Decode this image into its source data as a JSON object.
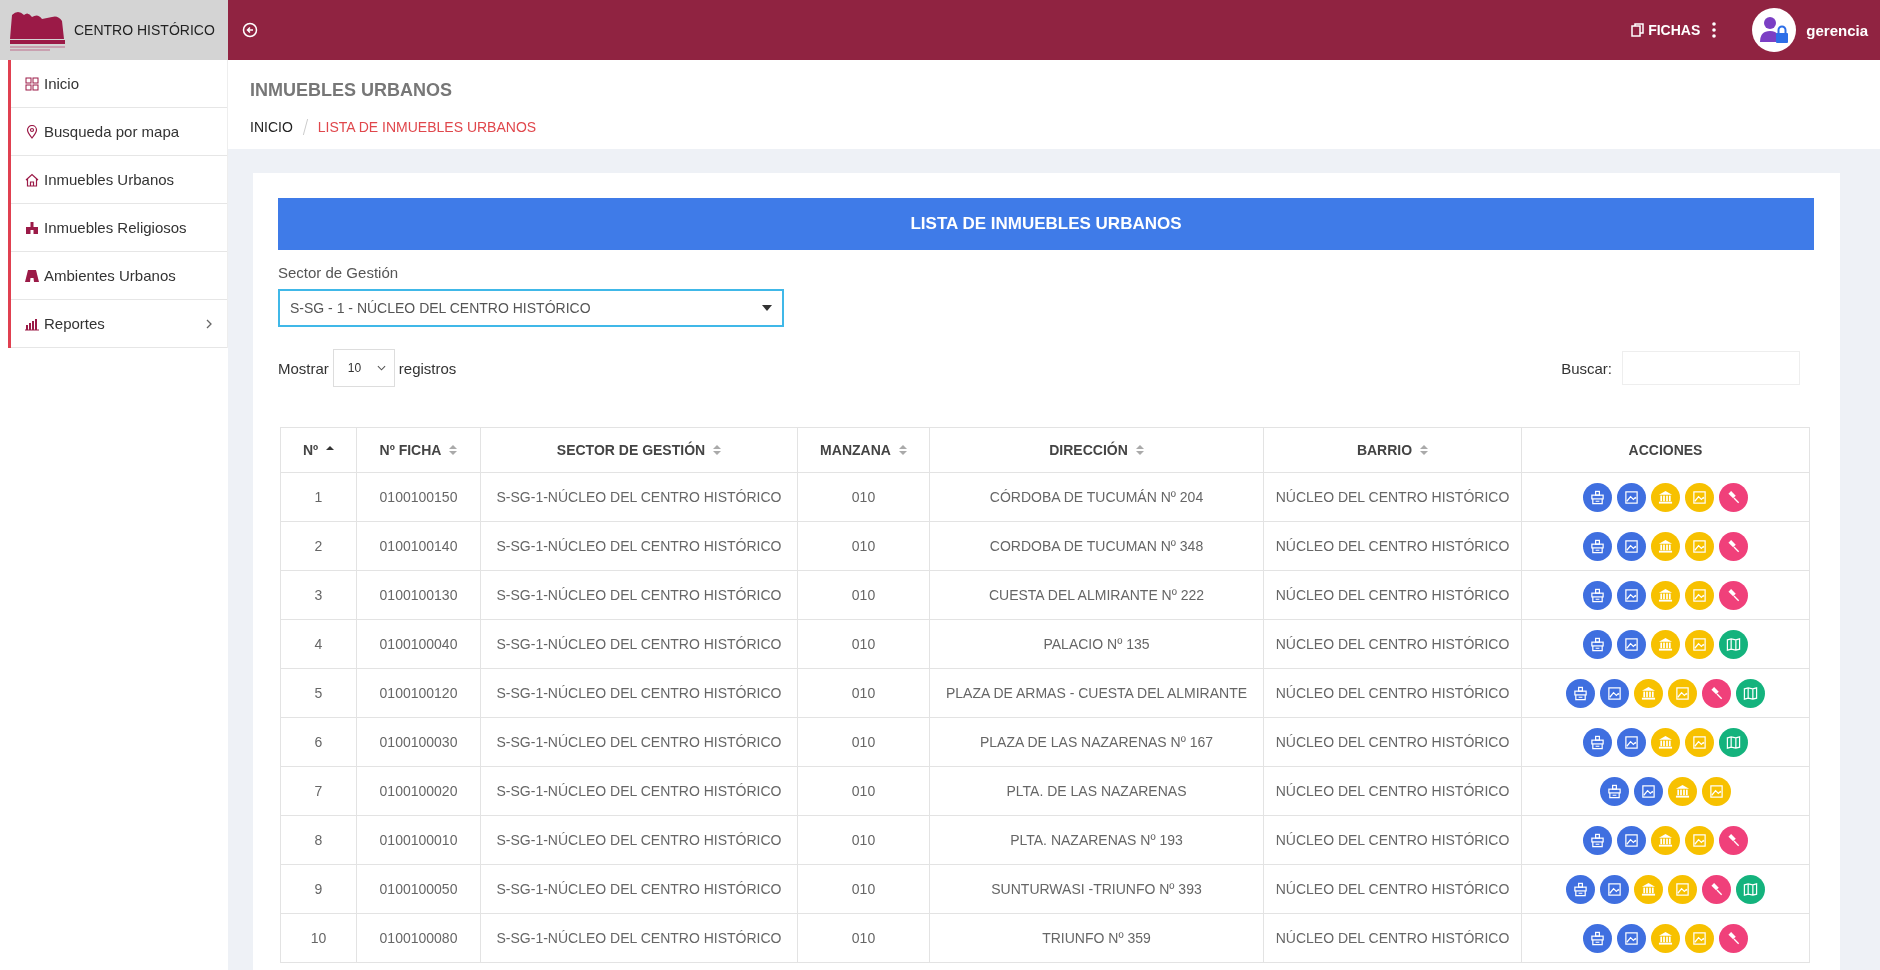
{
  "brand": {
    "title": "CENTRO HISTÓRICO"
  },
  "topbar": {
    "fichas_label": "FICHAS",
    "user": "gerencia"
  },
  "sidebar": {
    "items": [
      {
        "label": "Inicio",
        "kind": "grid",
        "has_submenu": false
      },
      {
        "label": "Busqueda por mapa",
        "kind": "pin",
        "has_submenu": false
      },
      {
        "label": "Inmuebles Urbanos",
        "kind": "house",
        "has_submenu": false
      },
      {
        "label": "Inmuebles Religiosos",
        "kind": "church",
        "has_submenu": false
      },
      {
        "label": "Ambientes Urbanos",
        "kind": "road",
        "has_submenu": false
      },
      {
        "label": "Reportes",
        "kind": "chart",
        "has_submenu": true
      }
    ]
  },
  "page": {
    "title": "INMUEBLES URBANOS",
    "breadcrumb": [
      {
        "label": "INICIO",
        "current": false
      },
      {
        "label": "LISTA DE INMUEBLES URBANOS",
        "current": true
      }
    ]
  },
  "panel": {
    "title": "LISTA DE INMUEBLES URBANOS",
    "filter_label": "Sector de Gestión",
    "filter_value": "S-SG - 1 - NÚCLEO DEL CENTRO HISTÓRICO",
    "show_before": "Mostrar",
    "show_value": "10",
    "show_after": "registros",
    "search_label": "Buscar:"
  },
  "table": {
    "columns": [
      {
        "label": "Nº",
        "kind": "asc"
      },
      {
        "label": "Nº FICHA",
        "kind": "both"
      },
      {
        "label": "SECTOR DE GESTIÓN",
        "kind": "both"
      },
      {
        "label": "MANZANA",
        "kind": "both"
      },
      {
        "label": "DIRECCIÓN",
        "kind": "both"
      },
      {
        "label": "BARRIO",
        "kind": "both"
      },
      {
        "label": "ACCIONES",
        "kind": "none"
      }
    ],
    "rows": [
      {
        "cells": [
          "1",
          "0100100150",
          "S-SG-1-NÚCLEO DEL CENTRO HISTÓRICO",
          "010",
          "CÓRDOBA DE TUCUMÁN Nº 204",
          "NÚCLEO DEL CENTRO HISTÓRICO"
        ],
        "actions": [
          {
            "kind": "ficha"
          },
          {
            "kind": "photo"
          },
          {
            "kind": "monument"
          },
          {
            "kind": "image"
          },
          {
            "kind": "gavel"
          }
        ]
      },
      {
        "cells": [
          "2",
          "0100100140",
          "S-SG-1-NÚCLEO DEL CENTRO HISTÓRICO",
          "010",
          "CORDOBA DE TUCUMAN Nº 348",
          "NÚCLEO DEL CENTRO HISTÓRICO"
        ],
        "actions": [
          {
            "kind": "ficha"
          },
          {
            "kind": "photo"
          },
          {
            "kind": "monument"
          },
          {
            "kind": "image"
          },
          {
            "kind": "gavel"
          }
        ]
      },
      {
        "cells": [
          "3",
          "0100100130",
          "S-SG-1-NÚCLEO DEL CENTRO HISTÓRICO",
          "010",
          "CUESTA DEL ALMIRANTE Nº 222",
          "NÚCLEO DEL CENTRO HISTÓRICO"
        ],
        "actions": [
          {
            "kind": "ficha"
          },
          {
            "kind": "photo"
          },
          {
            "kind": "monument"
          },
          {
            "kind": "image"
          },
          {
            "kind": "gavel"
          }
        ]
      },
      {
        "cells": [
          "4",
          "0100100040",
          "S-SG-1-NÚCLEO DEL CENTRO HISTÓRICO",
          "010",
          "PALACIO Nº 135",
          "NÚCLEO DEL CENTRO HISTÓRICO"
        ],
        "actions": [
          {
            "kind": "ficha"
          },
          {
            "kind": "photo"
          },
          {
            "kind": "monument"
          },
          {
            "kind": "image"
          },
          {
            "kind": "map"
          }
        ]
      },
      {
        "cells": [
          "5",
          "0100100120",
          "S-SG-1-NÚCLEO DEL CENTRO HISTÓRICO",
          "010",
          "PLAZA DE ARMAS - CUESTA DEL ALMIRANTE",
          "NÚCLEO DEL CENTRO HISTÓRICO"
        ],
        "actions": [
          {
            "kind": "ficha"
          },
          {
            "kind": "photo"
          },
          {
            "kind": "monument"
          },
          {
            "kind": "image"
          },
          {
            "kind": "gavel"
          },
          {
            "kind": "map"
          }
        ]
      },
      {
        "cells": [
          "6",
          "0100100030",
          "S-SG-1-NÚCLEO DEL CENTRO HISTÓRICO",
          "010",
          "PLAZA DE LAS NAZARENAS Nº 167",
          "NÚCLEO DEL CENTRO HISTÓRICO"
        ],
        "actions": [
          {
            "kind": "ficha"
          },
          {
            "kind": "photo"
          },
          {
            "kind": "monument"
          },
          {
            "kind": "image"
          },
          {
            "kind": "map"
          }
        ]
      },
      {
        "cells": [
          "7",
          "0100100020",
          "S-SG-1-NÚCLEO DEL CENTRO HISTÓRICO",
          "010",
          "PLTA. DE LAS NAZARENAS",
          "NÚCLEO DEL CENTRO HISTÓRICO"
        ],
        "actions": [
          {
            "kind": "ficha"
          },
          {
            "kind": "photo"
          },
          {
            "kind": "monument"
          },
          {
            "kind": "image"
          }
        ]
      },
      {
        "cells": [
          "8",
          "0100100010",
          "S-SG-1-NÚCLEO DEL CENTRO HISTÓRICO",
          "010",
          "PLTA. NAZARENAS Nº 193",
          "NÚCLEO DEL CENTRO HISTÓRICO"
        ],
        "actions": [
          {
            "kind": "ficha"
          },
          {
            "kind": "photo"
          },
          {
            "kind": "monument"
          },
          {
            "kind": "image"
          },
          {
            "kind": "gavel"
          }
        ]
      },
      {
        "cells": [
          "9",
          "0100100050",
          "S-SG-1-NÚCLEO DEL CENTRO HISTÓRICO",
          "010",
          "SUNTURWASI -TRIUNFO Nº 393",
          "NÚCLEO DEL CENTRO HISTÓRICO"
        ],
        "actions": [
          {
            "kind": "ficha"
          },
          {
            "kind": "photo"
          },
          {
            "kind": "monument"
          },
          {
            "kind": "image"
          },
          {
            "kind": "gavel"
          },
          {
            "kind": "map"
          }
        ]
      },
      {
        "cells": [
          "10",
          "0100100080",
          "S-SG-1-NÚCLEO DEL CENTRO HISTÓRICO",
          "010",
          "TRIUNFO Nº 359",
          "NÚCLEO DEL CENTRO HISTÓRICO"
        ],
        "actions": [
          {
            "kind": "ficha"
          },
          {
            "kind": "photo"
          },
          {
            "kind": "monument"
          },
          {
            "kind": "image"
          },
          {
            "kind": "gavel"
          }
        ]
      }
    ]
  }
}
